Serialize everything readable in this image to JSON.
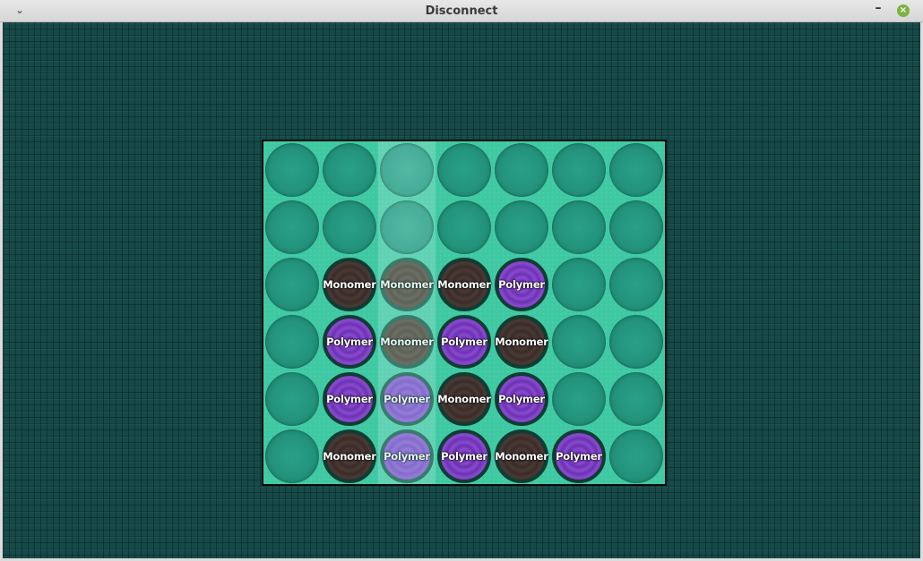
{
  "window": {
    "title": "Disconnect",
    "menu_icon": "chevron-down-icon",
    "minimize_icon": "minimize-icon",
    "close_icon": "close-icon"
  },
  "colors": {
    "board": "#3fc9a3",
    "background": "#164a49",
    "monomer": "#3a2b28",
    "polymer": "#6a32b0"
  },
  "game": {
    "columns": 7,
    "rows": 6,
    "highlighted_column": 2,
    "labels": {
      "monomer": "Monomer",
      "polymer": "Polymer"
    },
    "board": [
      [
        null,
        null,
        null,
        null,
        null,
        null,
        null
      ],
      [
        null,
        null,
        null,
        null,
        null,
        null,
        null
      ],
      [
        null,
        "Monomer",
        "Monomer",
        "Monomer",
        "Polymer",
        null,
        null
      ],
      [
        null,
        "Polymer",
        "Monomer",
        "Polymer",
        "Monomer",
        null,
        null
      ],
      [
        null,
        "Polymer",
        "Polymer",
        "Monomer",
        "Polymer",
        null,
        null
      ],
      [
        null,
        "Monomer",
        "Polymer",
        "Polymer",
        "Monomer",
        "Polymer",
        null
      ]
    ]
  }
}
